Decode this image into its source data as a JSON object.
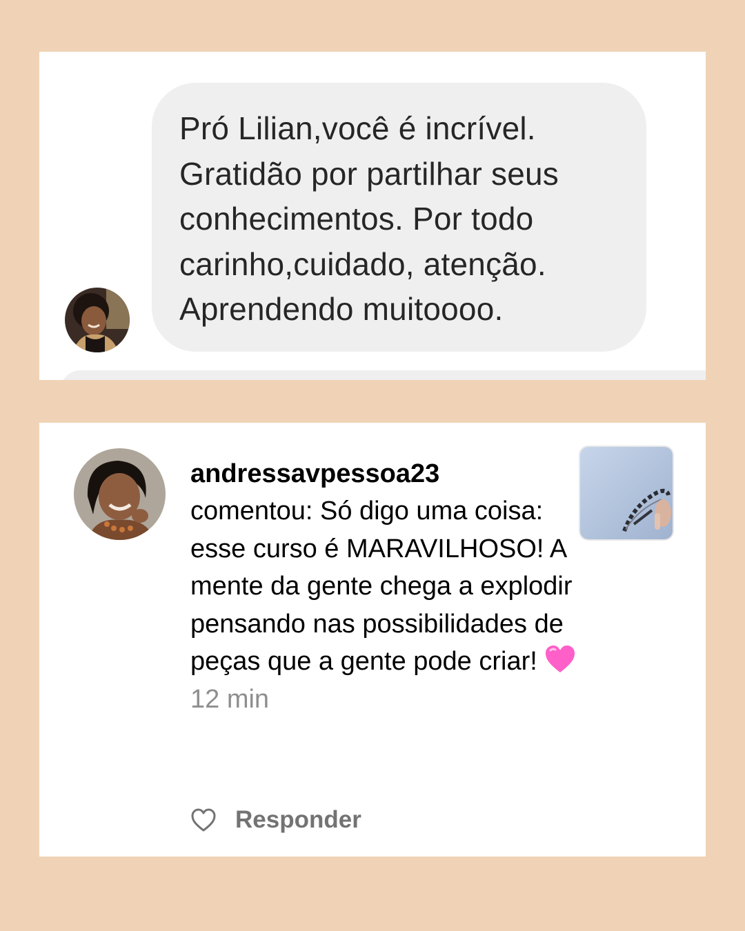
{
  "message_card": {
    "avatar_icon": "profile-photo-icon",
    "bubble_text": "Pró Lilian,você é incrível.\nGratidão por partilhar seus\nconhecimentos. Por todo\ncarinho,cuidado, atenção.\nAprendendo muitoooo."
  },
  "comment_card": {
    "avatar_icon": "profile-photo-icon",
    "username": "andressavpessoa23",
    "comment_text": "comentou: Só digo uma coisa: esse curso é MARAVILHOSO! A mente da gente chega a explodir pensando nas possibilidades de peças que a gente pode criar!",
    "emoji_icon": "pink-heart-emoji",
    "time": "12 min",
    "thumbnail_icon": "post-thumbnail-icon",
    "like_icon": "heart-outline-icon",
    "reply_label": "Responder"
  },
  "colors": {
    "background": "#f0d3b6",
    "card": "#ffffff",
    "bubble": "#efefef",
    "muted_text": "#8e8e8e",
    "emoji": "#ff5fc8"
  }
}
